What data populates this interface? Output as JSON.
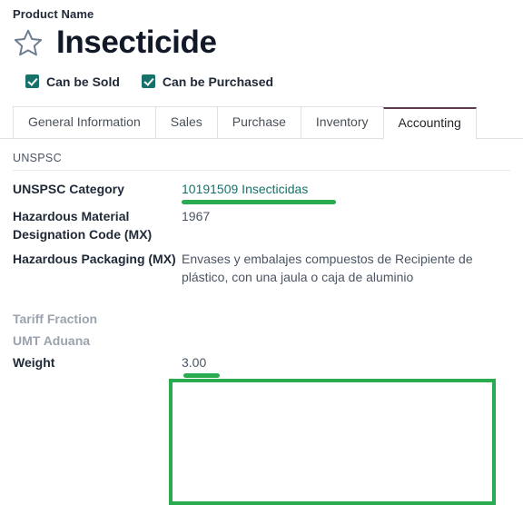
{
  "header": {
    "product_name_label": "Product Name",
    "title": "Insecticide",
    "star_icon": "star-outline-icon"
  },
  "checkboxes": [
    {
      "label": "Can be Sold",
      "checked": true
    },
    {
      "label": "Can be Purchased",
      "checked": true
    }
  ],
  "tabs": [
    {
      "label": "General Information",
      "active": false
    },
    {
      "label": "Sales",
      "active": false
    },
    {
      "label": "Purchase",
      "active": false
    },
    {
      "label": "Inventory",
      "active": false
    },
    {
      "label": "Accounting",
      "active": true
    }
  ],
  "form": {
    "section_title": "UNSPSC",
    "fields": {
      "unspsc_category": {
        "label": "UNSPSC Category",
        "value": "10191509 Insecticidas"
      },
      "hazmat_code": {
        "label": "Hazardous Material Designation Code (MX)",
        "value": "1967"
      },
      "haz_packaging": {
        "label": "Hazardous Packaging (MX)",
        "value": "Envases y embalajes compuestos de Recipiente de plástico, con una jaula o caja de aluminio"
      },
      "tariff_fraction": {
        "label": "Tariff Fraction",
        "value": ""
      },
      "umt_aduana": {
        "label": "UMT Aduana",
        "value": ""
      },
      "weight": {
        "label": "Weight",
        "value": "3.00"
      }
    }
  },
  "annotations": {
    "highlight_color": "#2bab4f",
    "accent_color": "#17726b",
    "active_tab_border": "#5c3b4d"
  }
}
